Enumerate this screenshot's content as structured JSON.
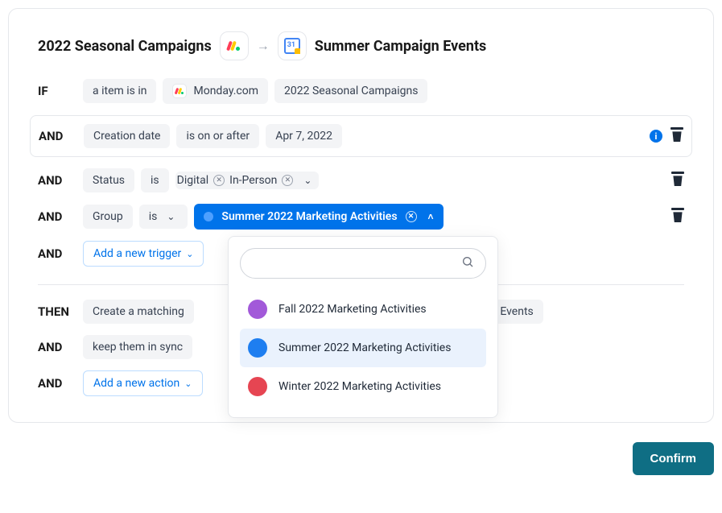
{
  "header": {
    "source_title": "2022 Seasonal Campaigns",
    "dest_title": "Summer Campaign Events"
  },
  "if_block": {
    "kw": "IF",
    "item_chip": "a item is in",
    "app_chip": "Monday.com",
    "board_chip": "2022 Seasonal Campaigns"
  },
  "filters": [
    {
      "kw": "AND",
      "field": "Creation date",
      "op": "is on or after",
      "value": "Apr 7, 2022",
      "outlined": true,
      "has_info": true
    },
    {
      "kw": "AND",
      "field": "Status",
      "op": "is",
      "tags": [
        "Digital",
        "In-Person"
      ]
    },
    {
      "kw": "AND",
      "field": "Group",
      "op": "is",
      "selected_label": "Summer 2022 Marketing Activities",
      "dropdown_open": true
    }
  ],
  "dropdown": {
    "search_placeholder": "",
    "options": [
      {
        "label": "Fall 2022 Marketing Activities",
        "color": "#a259d9",
        "selected": false
      },
      {
        "label": "Summer 2022 Marketing Activities",
        "color": "#1e7ef0",
        "selected": true
      },
      {
        "label": "Winter 2022 Marketing Activities",
        "color": "#e64552",
        "selected": false
      }
    ]
  },
  "add_trigger": {
    "kw": "AND",
    "label": "Add a new trigger"
  },
  "then_block": {
    "kw": "THEN",
    "action_chip_prefix": "Create a matching",
    "action_chip_suffix": "ign Events"
  },
  "sync_row": {
    "kw": "AND",
    "chip": "keep them in sync"
  },
  "add_action": {
    "kw": "AND",
    "label": "Add a new action"
  },
  "confirm_label": "Confirm"
}
